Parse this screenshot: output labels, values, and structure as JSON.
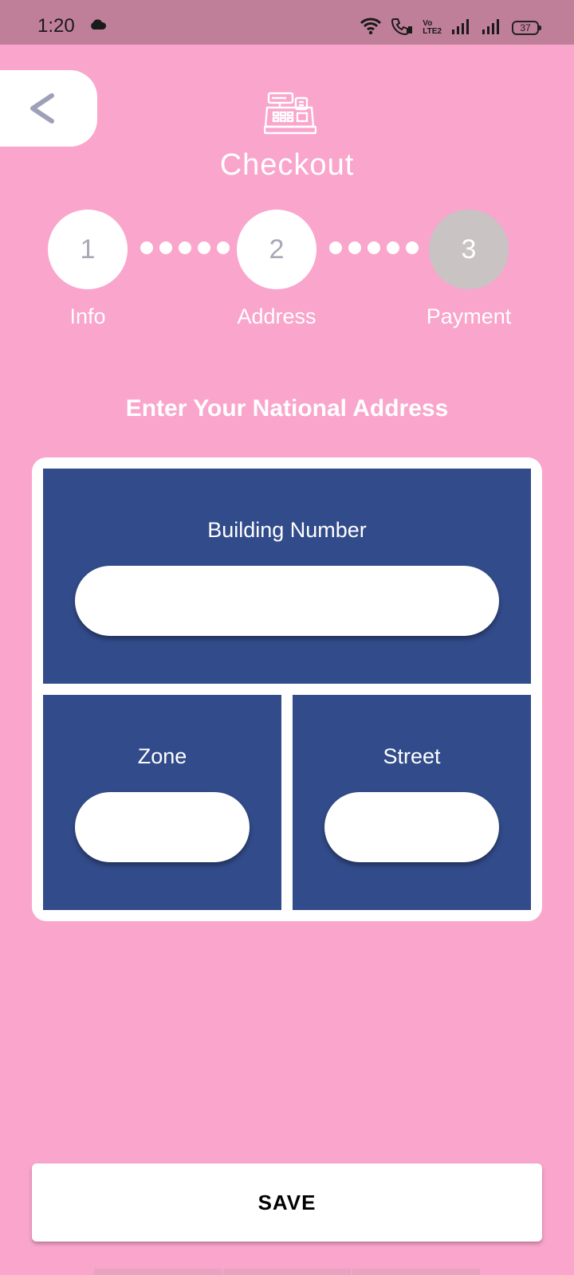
{
  "status_bar": {
    "time": "1:20",
    "volte_top": "Vo",
    "volte_bottom": "LTE2",
    "battery": "37"
  },
  "header": {
    "title": "Checkout",
    "icon": "cash-register-icon",
    "back_icon": "chevron-left-icon"
  },
  "stepper": {
    "steps": [
      {
        "number": "1",
        "label": "Info",
        "state": "complete"
      },
      {
        "number": "2",
        "label": "Address",
        "state": "complete"
      },
      {
        "number": "3",
        "label": "Payment",
        "state": "pending"
      }
    ]
  },
  "form": {
    "heading": "Enter Your National Address",
    "building_number": {
      "label": "Building Number",
      "value": ""
    },
    "zone": {
      "label": "Zone",
      "value": ""
    },
    "street": {
      "label": "Street",
      "value": ""
    }
  },
  "actions": {
    "save_label": "SAVE"
  },
  "colors": {
    "background": "#f9a5cc",
    "status_bar": "#bf7f98",
    "panel": "#324b8a",
    "step_active": "#ffffff",
    "step_inactive": "#c9c3c3"
  }
}
